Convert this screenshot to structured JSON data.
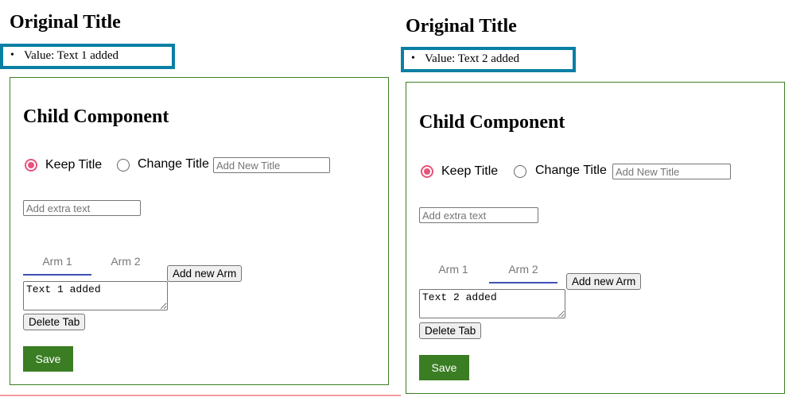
{
  "panels": [
    {
      "title": "Original Title",
      "value_text": "Value: Text 1 added",
      "child": {
        "heading": "Child Component",
        "radio_keep": "Keep Title",
        "radio_change": "Change Title",
        "keep_selected": true,
        "new_title_placeholder": "Add New Title",
        "extra_text_placeholder": "Add extra text",
        "tabs": [
          {
            "label": "Arm 1",
            "active": true
          },
          {
            "label": "Arm 2",
            "active": false
          }
        ],
        "add_arm_label": "Add new Arm",
        "textarea_value": "Text 1 added",
        "delete_tab_label": "Delete Tab",
        "save_label": "Save"
      }
    },
    {
      "title": "Original Title",
      "value_text": "Value: Text 2 added",
      "child": {
        "heading": "Child Component",
        "radio_keep": "Keep Title",
        "radio_change": "Change Title",
        "keep_selected": true,
        "new_title_placeholder": "Add New Title",
        "extra_text_placeholder": "Add extra text",
        "tabs": [
          {
            "label": "Arm 1",
            "active": false
          },
          {
            "label": "Arm 2",
            "active": true
          }
        ],
        "add_arm_label": "Add new Arm",
        "textarea_value": "Text 2 added",
        "delete_tab_label": "Delete Tab",
        "save_label": "Save"
      }
    }
  ],
  "bullet": "•",
  "colors": {
    "value_border": "#0a7fa4",
    "child_border": "#3a8022",
    "save_bg": "#3a7d23",
    "radio_accent": "#e8537a",
    "tab_underline": "#3f51b5",
    "divider": "#f29a9a"
  }
}
